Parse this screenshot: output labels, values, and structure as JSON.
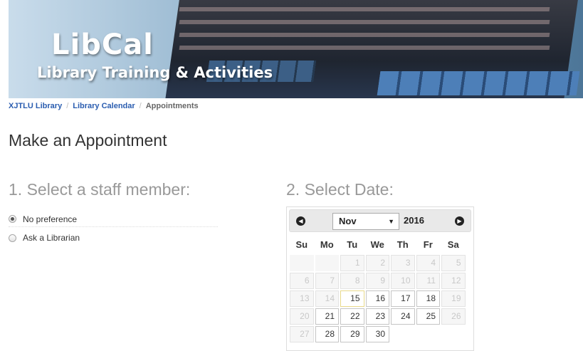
{
  "banner": {
    "title": "LibCal",
    "subtitle": "Library Training & Activities"
  },
  "breadcrumb": {
    "items": [
      "XJTLU Library",
      "Library Calendar"
    ],
    "current": "Appointments",
    "separator": "/"
  },
  "page": {
    "title": "Make an Appointment"
  },
  "staff_section": {
    "heading": "1. Select a staff member:",
    "options": [
      {
        "label": "No preference",
        "checked": true
      },
      {
        "label": "Ask a Librarian",
        "checked": false
      }
    ]
  },
  "date_section": {
    "heading": "2. Select Date:",
    "calendar": {
      "month": "Nov",
      "year": "2016",
      "prev_icon": "circle-arrow-left-icon",
      "next_icon": "circle-arrow-right-icon",
      "weekdays": [
        "Su",
        "Mo",
        "Tu",
        "We",
        "Th",
        "Fr",
        "Sa"
      ],
      "weeks": [
        [
          "",
          "",
          "1",
          "2",
          "3",
          "4",
          "5"
        ],
        [
          "6",
          "7",
          "8",
          "9",
          "10",
          "11",
          "12"
        ],
        [
          "13",
          "14",
          "15",
          "16",
          "17",
          "18",
          "19"
        ],
        [
          "20",
          "21",
          "22",
          "23",
          "24",
          "25",
          "26"
        ],
        [
          "27",
          "28",
          "29",
          "30",
          "",
          "",
          ""
        ]
      ],
      "available_days": [
        "15",
        "16",
        "17",
        "18",
        "21",
        "22",
        "23",
        "24",
        "25",
        "28",
        "29",
        "30"
      ],
      "today": "15"
    }
  },
  "colors": {
    "link": "#2a5db0",
    "heading_gray": "#999999",
    "today_border": "#e8d98a"
  }
}
